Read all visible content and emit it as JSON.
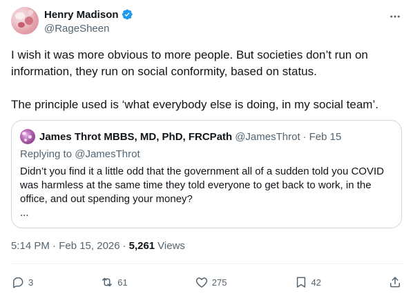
{
  "author": {
    "display_name": "Henry Madison",
    "handle": "@RageSheen",
    "verified_icon": "verified-badge-icon"
  },
  "post": {
    "paragraphs": [
      "I wish it was more obvious to more people. But societies don’t run on information, they run on social conformity, based on status.",
      "The principle used is ‘what everybody else is doing, in my social team’."
    ],
    "timestamp": "5:14 PM · Feb 15, 2026",
    "views_count": "5,261",
    "views_label": "Views"
  },
  "quote": {
    "display_name": "James Throt MBBS, MD, PhD, FRCPath",
    "handle": "@JamesThrot",
    "date": "Feb 15",
    "replying_label": "Replying to",
    "replying_handle": "@JamesThrot",
    "text": "Didn’t you find it a little odd that the government all of a sudden told you COVID was harmless at the same time they told everyone to get back to work, in the office, and out spending your money?",
    "ellipsis": "..."
  },
  "actions": {
    "replies": "3",
    "reposts": "61",
    "likes": "275",
    "bookmarks": "42"
  },
  "colors": {
    "text_primary": "#0f1419",
    "text_secondary": "#536471",
    "verified_blue": "#1d9bf0",
    "border": "#cfd9de"
  }
}
